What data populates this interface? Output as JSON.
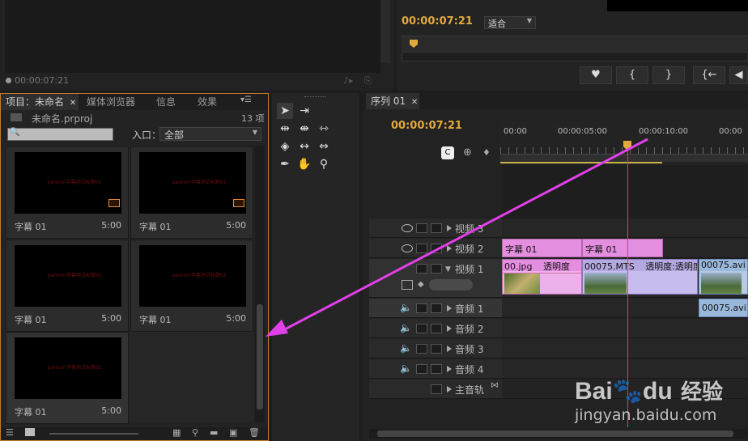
{
  "source_monitor": {
    "timecode": "00:00:07:21"
  },
  "program_monitor": {
    "timecode": "00:00:07:21",
    "fit_value": "适合",
    "buttons": [
      "♥",
      "{",
      "}",
      "{←",
      "◀"
    ]
  },
  "project_panel": {
    "tabs": [
      "项目：未命名",
      "媒体浏览器",
      "信息",
      "效果"
    ],
    "file_name": "未命名.prproj",
    "item_count": "13 项",
    "search_icon": "🔍",
    "entry_label": "入口：",
    "entry_value": "全部",
    "thumbs": [
      {
        "name": "字幕 01",
        "duration": "5:00",
        "red_text": "pantom字幕测试标题01"
      },
      {
        "name": "字幕 01",
        "duration": "5:00",
        "red_text": "pantom字幕测试标题01"
      },
      {
        "name": "字幕 01",
        "duration": "5:00",
        "red_text": "pantom字幕测试标题02"
      },
      {
        "name": "字幕 01",
        "duration": "5:00",
        "red_text": "pantom字幕测试标题02"
      },
      {
        "name": "字幕 01",
        "duration": "5:00",
        "red_text": "pantom字幕测试标题02"
      }
    ]
  },
  "sequence": {
    "tab": "序列 01",
    "timecode": "00:00:07:21",
    "ruler": [
      "00:00",
      "00:00:05:00",
      "00:00:10:00",
      "00:00"
    ],
    "tracks_video": [
      "视频 3",
      "视频 2",
      "视频 1"
    ],
    "tracks_audio": [
      "音频 1",
      "音频 2",
      "音频 3",
      "音频 4"
    ],
    "master": "主音轨",
    "clips": {
      "v2a": "字幕 01",
      "v2b": "字幕 01",
      "v1a": "00.jpg",
      "v1a_fx": "透明度",
      "v1b": "00075.MTS",
      "v1b_fx": "透明度:透明度",
      "v1c": "00075.avi",
      "a1": "00075.avi"
    }
  },
  "watermark": {
    "brand": "Bai",
    "brand2": "du",
    "cn": "经验",
    "url": "jingyan.baidu.com"
  },
  "colors": {
    "accent": "#e3a93b",
    "title_clip": "#e48ee0",
    "video_clip": "#b4a8e0",
    "audio_clip": "#9ab8dc",
    "arrow": "#e040e8"
  }
}
